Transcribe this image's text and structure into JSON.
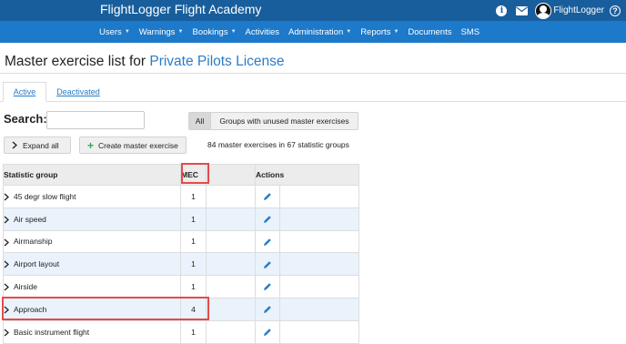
{
  "app": {
    "title": "FlightLogger Flight Academy",
    "user_name": "FlightLogger",
    "icons": [
      "info-icon",
      "mail-icon",
      "avatar",
      "help-icon"
    ]
  },
  "nav": {
    "items": [
      {
        "label": "Users",
        "has_caret": true
      },
      {
        "label": "Warnings",
        "has_caret": true
      },
      {
        "label": "Bookings",
        "has_caret": true
      },
      {
        "label": "Activities",
        "has_caret": false
      },
      {
        "label": "Administration",
        "has_caret": true
      },
      {
        "label": "Reports",
        "has_caret": true
      },
      {
        "label": "Documents",
        "has_caret": false
      },
      {
        "label": "SMS",
        "has_caret": false
      }
    ]
  },
  "page": {
    "title_prefix": "Master exercise list for",
    "title_link": "Private Pilots License"
  },
  "tabs": {
    "active": "Active",
    "deactivated": "Deactivated"
  },
  "search": {
    "label": "Search:",
    "value": "",
    "placeholder": ""
  },
  "filters": {
    "all": "All",
    "unused": "Groups with unused master exercises",
    "selected": "All"
  },
  "toolbar": {
    "expand_all": "Expand all",
    "create": "Create master exercise",
    "summary": "84 master exercises in 67 statistic groups"
  },
  "table": {
    "headers": {
      "group": "Statistic group",
      "mec": "MEC",
      "actions": "Actions"
    },
    "rows": [
      {
        "group": "45 degr slow flight",
        "mec": "1"
      },
      {
        "group": "Air speed",
        "mec": "1"
      },
      {
        "group": "Airmanship",
        "mec": "1"
      },
      {
        "group": "Airport layout",
        "mec": "1"
      },
      {
        "group": "Airside",
        "mec": "1"
      },
      {
        "group": "Approach",
        "mec": "4"
      },
      {
        "group": "Basic instrument flight",
        "mec": "1"
      }
    ]
  },
  "colors": {
    "topbar": "#185e9c",
    "navbar": "#1d79c9",
    "link": "#2a7cc7",
    "highlight": "#e34b4b",
    "row_alt": "#eaf2fb",
    "plus": "#3aa655"
  }
}
